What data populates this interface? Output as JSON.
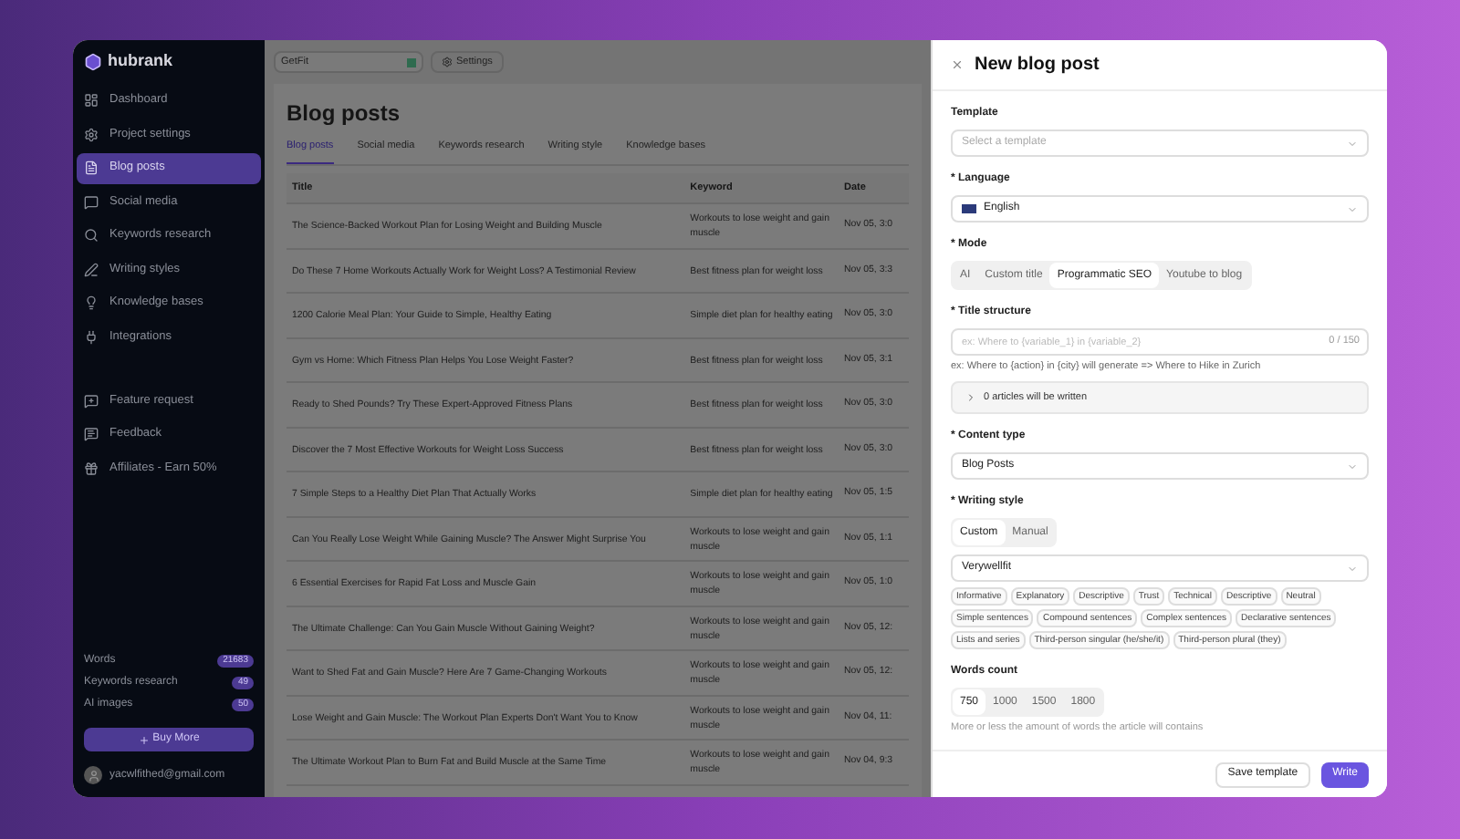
{
  "sidebar": {
    "logo": "hubrank",
    "items": [
      {
        "label": "Dashboard",
        "selected": false
      },
      {
        "label": "Project settings",
        "selected": false
      },
      {
        "label": "Blog posts",
        "selected": true
      },
      {
        "label": "Social media",
        "selected": false
      },
      {
        "label": "Keywords research",
        "selected": false
      },
      {
        "label": "Writing styles",
        "selected": false
      },
      {
        "label": "Knowledge bases",
        "selected": false
      },
      {
        "label": "Integrations",
        "selected": false
      }
    ],
    "bottom_items": [
      {
        "label": "Feature request",
        "selected": false
      },
      {
        "label": "Feedback",
        "selected": false
      },
      {
        "label": "Affiliates - Earn 50%",
        "selected": false
      }
    ],
    "usage": [
      {
        "label": "Words",
        "count": "21683"
      },
      {
        "label": "Keywords research",
        "count": "49"
      },
      {
        "label": "AI images",
        "count": "50"
      }
    ],
    "buy_button": "Buy More",
    "user_email": "yacwlfithed@gmail.com"
  },
  "topbar": {
    "project": "GetFit",
    "settings_button": "Settings"
  },
  "page": {
    "title": "Blog posts",
    "tabs": [
      {
        "label": "Blog posts",
        "selected": true
      },
      {
        "label": "Social media",
        "selected": false
      },
      {
        "label": "Keywords research",
        "selected": false
      },
      {
        "label": "Writing style",
        "selected": false
      },
      {
        "label": "Knowledge bases",
        "selected": false
      }
    ],
    "table": {
      "columns": [
        "Title",
        "Keyword",
        "Date"
      ],
      "rows": [
        [
          "The Science-Backed Workout Plan for Losing Weight and Building Muscle",
          "Workouts to lose weight and gain muscle",
          "Nov 05, 3:0"
        ],
        [
          "Do These 7 Home Workouts Actually Work for Weight Loss? A Testimonial Review",
          "Best fitness plan for weight loss",
          "Nov 05, 3:3"
        ],
        [
          "1200 Calorie Meal Plan: Your Guide to Simple, Healthy Eating",
          "Simple diet plan for healthy eating",
          "Nov 05, 3:0"
        ],
        [
          "Gym vs Home: Which Fitness Plan Helps You Lose Weight Faster?",
          "Best fitness plan for weight loss",
          "Nov 05, 3:1"
        ],
        [
          "Ready to Shed Pounds? Try These Expert-Approved Fitness Plans",
          "Best fitness plan for weight loss",
          "Nov 05, 3:0"
        ],
        [
          "Discover the 7 Most Effective Workouts for Weight Loss Success",
          "Best fitness plan for weight loss",
          "Nov 05, 3:0"
        ],
        [
          "7 Simple Steps to a Healthy Diet Plan That Actually Works",
          "Simple diet plan for healthy eating",
          "Nov 05, 1:5"
        ],
        [
          "Can You Really Lose Weight While Gaining Muscle? The Answer Might Surprise You",
          "Workouts to lose weight and gain muscle",
          "Nov 05, 1:1"
        ],
        [
          "6 Essential Exercises for Rapid Fat Loss and Muscle Gain",
          "Workouts to lose weight and gain muscle",
          "Nov 05, 1:0"
        ],
        [
          "The Ultimate Challenge: Can You Gain Muscle Without Gaining Weight?",
          "Workouts to lose weight and gain muscle",
          "Nov 05, 12:"
        ],
        [
          "Want to Shed Fat and Gain Muscle? Here Are 7 Game-Changing Workouts",
          "Workouts to lose weight and gain muscle",
          "Nov 05, 12:"
        ],
        [
          "Lose Weight and Gain Muscle: The Workout Plan Experts Don't Want You to Know",
          "Workouts to lose weight and gain muscle",
          "Nov 04, 11:"
        ],
        [
          "The Ultimate Workout Plan to Burn Fat and Build Muscle at the Same Time",
          "Workouts to lose weight and gain muscle",
          "Nov 04, 9:3"
        ]
      ]
    }
  },
  "panel": {
    "title": "New blog post",
    "template": {
      "label": "Template",
      "placeholder": "Select a template"
    },
    "language": {
      "label": "* Language",
      "value": "English"
    },
    "mode": {
      "label": "* Mode",
      "options": [
        {
          "label": "AI",
          "selected": false
        },
        {
          "label": "Custom title",
          "selected": false
        },
        {
          "label": "Programmatic SEO",
          "selected": true
        },
        {
          "label": "Youtube to blog",
          "selected": false
        }
      ]
    },
    "title_structure": {
      "label": "* Title structure",
      "placeholder": "ex: Where to {variable_1} in {variable_2}",
      "counter": "0 / 150",
      "hint": "ex: Where to {action} in {city} will generate => Where to Hike in Zurich",
      "preview": "0 articles will be written"
    },
    "content_type": {
      "label": "* Content type",
      "value": "Blog Posts"
    },
    "writing_style": {
      "label": "* Writing style",
      "options": [
        {
          "label": "Custom",
          "selected": true
        },
        {
          "label": "Manual",
          "selected": false
        }
      ],
      "value": "Verywellfit",
      "tags": [
        "Informative",
        "Explanatory",
        "Descriptive",
        "Trust",
        "Technical",
        "Descriptive",
        "Neutral",
        "Simple sentences",
        "Compound sentences",
        "Complex sentences",
        "Declarative sentences",
        "Lists and series",
        "Third-person singular (he/she/it)",
        "Third-person plural (they)"
      ]
    },
    "words_count": {
      "label": "Words count",
      "options": [
        {
          "label": "750",
          "selected": true
        },
        {
          "label": "1000",
          "selected": false
        },
        {
          "label": "1500",
          "selected": false
        },
        {
          "label": "1800",
          "selected": false
        }
      ],
      "hint": "More or less the amount of words the article will contains"
    },
    "buttons": {
      "save": "Save template",
      "write": "Write"
    }
  }
}
